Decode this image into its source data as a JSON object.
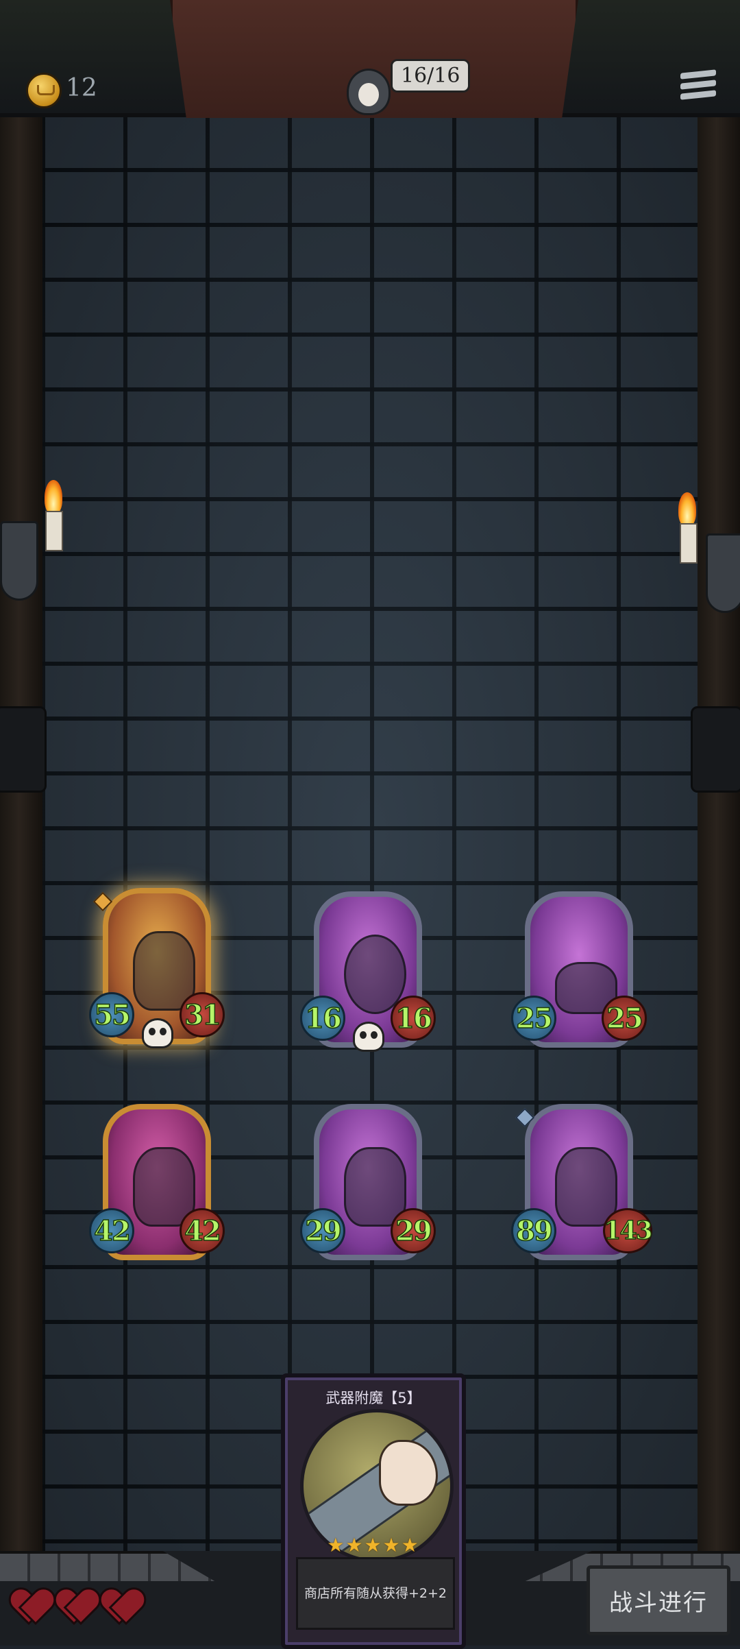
{
  "hud": {
    "gold": "12",
    "health": "16/16",
    "menu_icon": "hamburger-menu-icon",
    "coin_icon": "crown-coin-icon"
  },
  "board": {
    "minions": [
      {
        "attack": "55",
        "health": "31",
        "frame": "gold",
        "highlighted": true,
        "deathrattle": true,
        "tier": "gold"
      },
      {
        "attack": "16",
        "health": "16",
        "frame": "purple",
        "highlighted": false,
        "deathrattle": true
      },
      {
        "attack": "25",
        "health": "25",
        "frame": "purple",
        "highlighted": false,
        "deathrattle": false
      },
      {
        "attack": "42",
        "health": "42",
        "frame": "gold",
        "highlighted": false,
        "deathrattle": false
      },
      {
        "attack": "29",
        "health": "29",
        "frame": "purple",
        "highlighted": false,
        "deathrattle": false
      },
      {
        "attack": "89",
        "health": "143",
        "frame": "purple",
        "highlighted": false,
        "deathrattle": false,
        "tier": "blue"
      }
    ]
  },
  "spell_card": {
    "title": "武器附魔【5】",
    "stars": "★★★★★",
    "description": "商店所有随从获得+2+2"
  },
  "lives": {
    "total": 3,
    "filled": 3
  },
  "actions": {
    "battle_label": "战斗进行"
  },
  "colors": {
    "wall": "#2f3a45",
    "stat_text": "#b6f56a",
    "attack_badge": "#4e8fb7",
    "health_badge": "#c44a3e",
    "gold_frame": "#c98d33",
    "purple_frame": "#6a6e87"
  }
}
